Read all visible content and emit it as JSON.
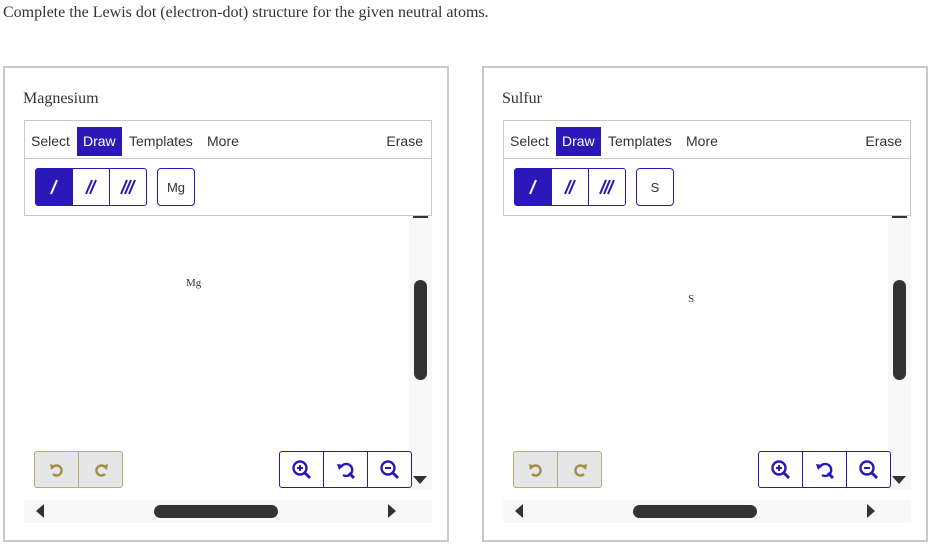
{
  "question": "Complete the Lewis dot (electron-dot) structure for the given neutral atoms.",
  "colors": {
    "accent": "#2a18b8",
    "undo_border": "#b9ad6e",
    "undo_icon": "#9e8f45",
    "panel_border": "#c8c8c8",
    "scroll_thumb": "#333333"
  },
  "panels": [
    {
      "title": "Magnesium",
      "menu": {
        "select": "Select",
        "draw": "Draw",
        "templates": "Templates",
        "more": "More",
        "erase": "Erase"
      },
      "atom_button": "Mg",
      "canvas_atom": "Mg"
    },
    {
      "title": "Sulfur",
      "menu": {
        "select": "Select",
        "draw": "Draw",
        "templates": "Templates",
        "more": "More",
        "erase": "Erase"
      },
      "atom_button": "S",
      "canvas_atom": "S"
    }
  ]
}
